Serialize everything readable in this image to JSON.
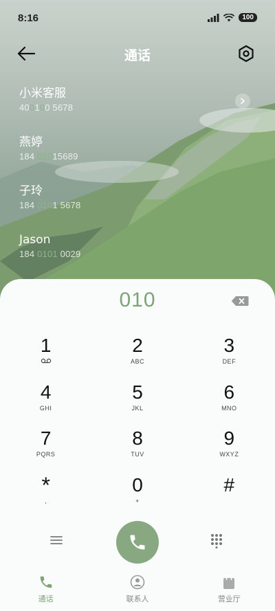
{
  "status_bar": {
    "time": "8:16",
    "battery": "100"
  },
  "header": {
    "title": "通话",
    "back_icon": "arrow-left-icon",
    "settings_icon": "settings-gear-icon"
  },
  "contacts": [
    {
      "name": "小米客服",
      "number_parts": [
        "40",
        "0",
        "1",
        "0",
        "0 5678"
      ],
      "highlight": [
        false,
        true,
        false,
        true,
        false
      ],
      "has_more": true
    },
    {
      "name": "燕婷",
      "number_parts": [
        "184 ",
        "010",
        "15689"
      ],
      "highlight": [
        false,
        true,
        false
      ],
      "has_more": false
    },
    {
      "name": "子玲",
      "number_parts": [
        "184 ",
        "010",
        "1 5678"
      ],
      "highlight": [
        false,
        true,
        false
      ],
      "has_more": false
    },
    {
      "name": "Jason",
      "number_parts": [
        "184 ",
        "0101",
        " 0029"
      ],
      "highlight": [
        false,
        true,
        false
      ],
      "has_more": false
    }
  ],
  "dialer": {
    "input_value": "010",
    "delete_icon": "backspace-icon"
  },
  "keypad": [
    [
      {
        "digit": "1",
        "letters": "voicemail-icon"
      },
      {
        "digit": "2",
        "letters": "ABC"
      },
      {
        "digit": "3",
        "letters": "DEF"
      }
    ],
    [
      {
        "digit": "4",
        "letters": "GHI"
      },
      {
        "digit": "5",
        "letters": "JKL"
      },
      {
        "digit": "6",
        "letters": "MNO"
      }
    ],
    [
      {
        "digit": "7",
        "letters": "PQRS"
      },
      {
        "digit": "8",
        "letters": "TUV"
      },
      {
        "digit": "9",
        "letters": "WXYZ"
      }
    ],
    [
      {
        "digit": "*",
        "letters": ","
      },
      {
        "digit": "0",
        "letters": "+"
      },
      {
        "digit": "#",
        "letters": ""
      }
    ]
  ],
  "actions": {
    "menu_icon": "menu-icon",
    "call_icon": "phone-icon",
    "keypad_icon": "dialpad-icon"
  },
  "bottom_nav": [
    {
      "label": "通话",
      "icon": "phone-icon",
      "active": true
    },
    {
      "label": "联系人",
      "icon": "contact-icon",
      "active": false
    },
    {
      "label": "营业厅",
      "icon": "store-bag-icon",
      "active": false
    }
  ],
  "colors": {
    "accent": "#7da376",
    "call_button": "#88a881"
  }
}
